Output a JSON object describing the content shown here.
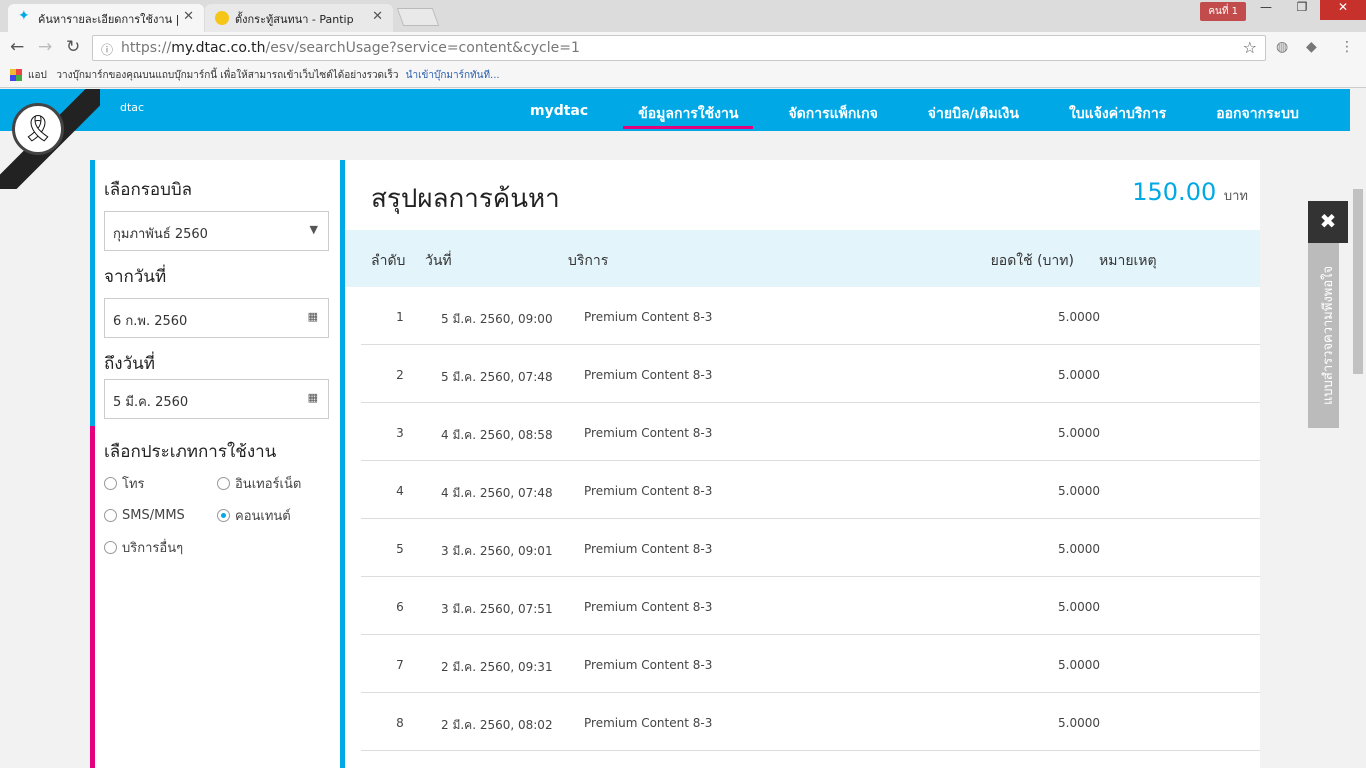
{
  "browser": {
    "tabs": [
      {
        "title": "ค้นหารายละเอียดการใช้งาน |",
        "active": true
      },
      {
        "title": "ตั้งกระทู้สนทนา - Pantip",
        "active": false
      }
    ],
    "user": "คนที่ 1",
    "url_prefix": "https://",
    "url_host": "my.dtac.co.th",
    "url_path": "/esv/searchUsage?service=content&cycle=1",
    "bookmarks_apps": "แอป",
    "bookmarks_hint": "วางบุ๊กมาร์กของคุณบนแถบบุ๊กมาร์กนี้ เพื่อให้สามารถเข้าเว็บไซต์ได้อย่างรวดเร็ว",
    "bookmarks_link": "นำเข้าบุ๊กมาร์กทันที..."
  },
  "header": {
    "logo": "dtac",
    "menu": [
      "mydtac",
      "ข้อมูลการใช้งาน",
      "จัดการแพ็กเกจ",
      "จ่ายบิล/เติมเงิน",
      "ใบแจ้งค่าบริการ",
      "ออกจากระบบ"
    ],
    "active_index": 1
  },
  "sidebar": {
    "cycle_label": "เลือกรอบบิล",
    "cycle_value": "กุมภาพันธ์ 2560",
    "from_label": "จากวันที่",
    "from_value": "6 ก.พ. 2560",
    "to_label": "ถึงวันที่",
    "to_value": "5 มี.ค. 2560",
    "type_label": "เลือกประเภทการใช้งาน",
    "types": [
      {
        "label": "โทร",
        "checked": false
      },
      {
        "label": "อินเทอร์เน็ต",
        "checked": false
      },
      {
        "label": "SMS/MMS",
        "checked": false
      },
      {
        "label": "คอนเทนต์",
        "checked": true
      },
      {
        "label": "บริการอื่นๆ",
        "checked": false
      }
    ]
  },
  "main": {
    "title": "สรุปผลการค้นหา",
    "total": "150.00",
    "currency": "บาท",
    "columns": [
      "ลำดับ",
      "วันที่",
      "บริการ",
      "ยอดใช้ (บาท)",
      "หมายเหตุ"
    ],
    "rows": [
      [
        "1",
        "5 มี.ค. 2560, 09:00",
        "Premium Content 8-3",
        "5.0000",
        ""
      ],
      [
        "2",
        "5 มี.ค. 2560, 07:48",
        "Premium Content 8-3",
        "5.0000",
        ""
      ],
      [
        "3",
        "4 มี.ค. 2560, 08:58",
        "Premium Content 8-3",
        "5.0000",
        ""
      ],
      [
        "4",
        "4 มี.ค. 2560, 07:48",
        "Premium Content 8-3",
        "5.0000",
        ""
      ],
      [
        "5",
        "3 มี.ค. 2560, 09:01",
        "Premium Content 8-3",
        "5.0000",
        ""
      ],
      [
        "6",
        "3 มี.ค. 2560, 07:51",
        "Premium Content 8-3",
        "5.0000",
        ""
      ],
      [
        "7",
        "2 มี.ค. 2560, 09:31",
        "Premium Content 8-3",
        "5.0000",
        ""
      ],
      [
        "8",
        "2 มี.ค. 2560, 08:02",
        "Premium Content 8-3",
        "5.0000",
        ""
      ]
    ]
  },
  "survey": {
    "close": "✖",
    "label": "แบบสำรวจความพึงพอใจ"
  }
}
